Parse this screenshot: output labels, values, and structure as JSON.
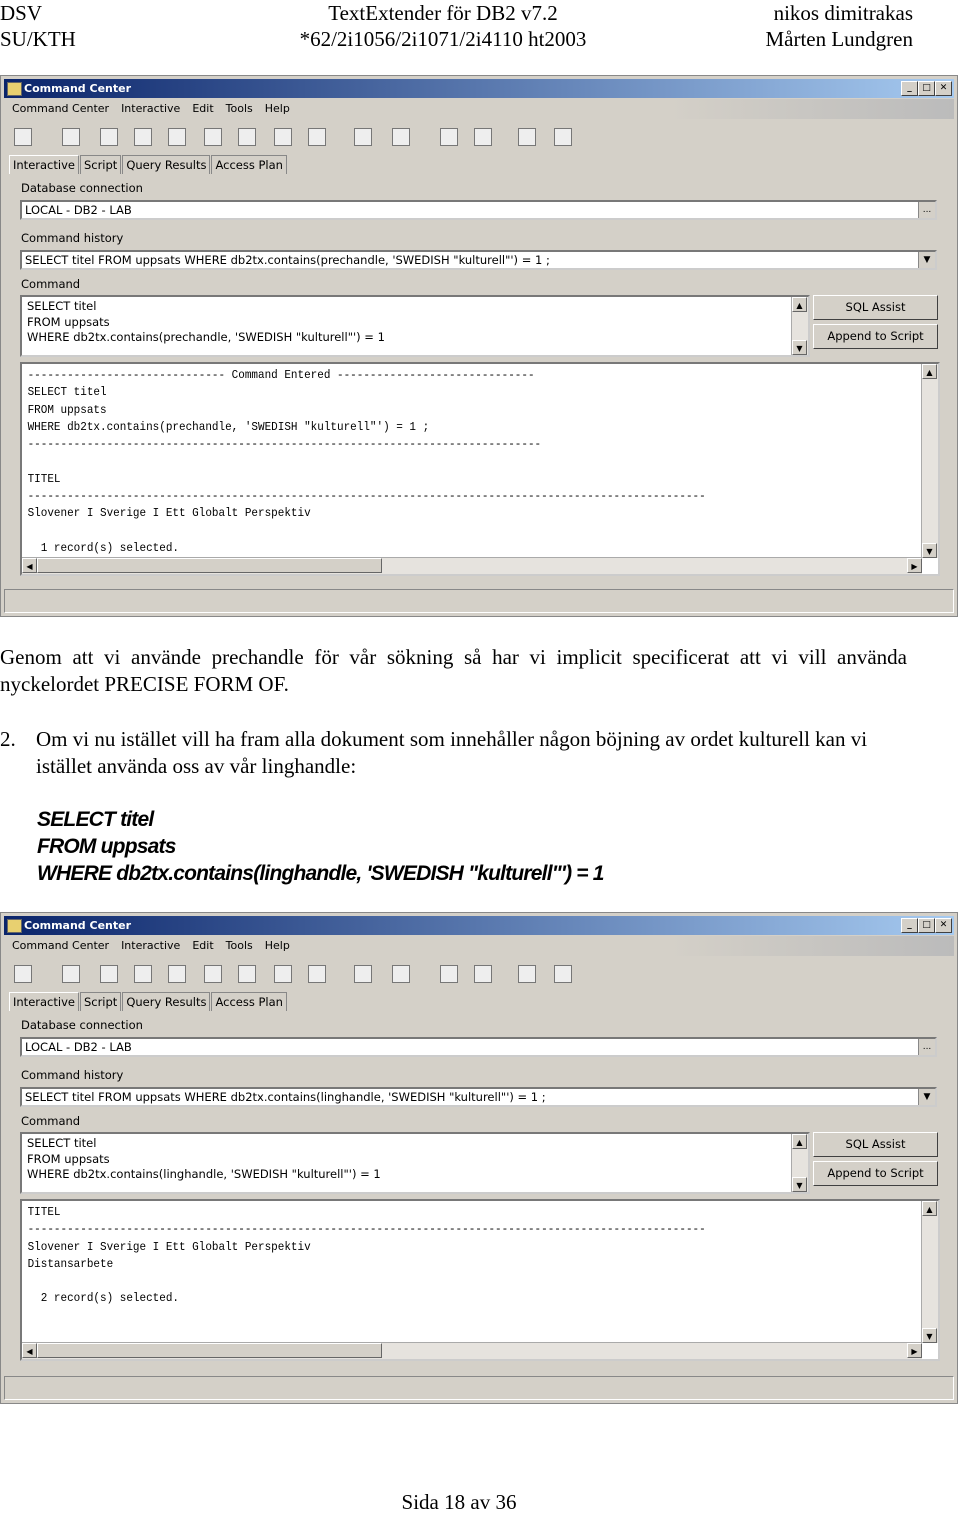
{
  "header": {
    "left1": "DSV",
    "left2": "SU/KTH",
    "center1": "TextExtender för DB2 v7.2",
    "center2": "*62/2i1056/2i1071/2i4110 ht2003",
    "right1": "nikos dimitrakas",
    "right2": "Mårten Lundgren"
  },
  "windows": [
    {
      "title": "Command Center",
      "menu": [
        "Command Center",
        "Interactive",
        "Edit",
        "Tools",
        "Help"
      ],
      "tabs": [
        "Interactive",
        "Script",
        "Query Results",
        "Access Plan"
      ],
      "db_label": "Database connection",
      "db_value": "LOCAL - DB2 - LAB",
      "history_label": "Command history",
      "history_value": "SELECT titel FROM uppsats WHERE db2tx.contains(prechandle, 'SWEDISH \"kulturell\"') = 1 ;",
      "command_label": "Command",
      "command_lines": [
        "SELECT titel",
        "FROM uppsats",
        "WHERE db2tx.contains(prechandle, 'SWEDISH \"kulturell\"') = 1"
      ],
      "sql_assist": "SQL Assist",
      "append_script": "Append to Script",
      "output": "------------------------------ Command Entered ------------------------------\nSELECT titel\nFROM uppsats\nWHERE db2tx.contains(prechandle, 'SWEDISH \"kulturell\"') = 1 ;\n------------------------------------------------------------------------------\n\nTITEL\n-------------------------------------------------------------------------------------------------------\nSlovener I Sverige I Ett Globalt Perspektiv\n\n  1 record(s) selected."
    },
    {
      "title": "Command Center",
      "menu": [
        "Command Center",
        "Interactive",
        "Edit",
        "Tools",
        "Help"
      ],
      "tabs": [
        "Interactive",
        "Script",
        "Query Results",
        "Access Plan"
      ],
      "db_label": "Database connection",
      "db_value": "LOCAL - DB2 - LAB",
      "history_label": "Command history",
      "history_value": "SELECT titel FROM uppsats WHERE db2tx.contains(linghandle, 'SWEDISH \"kulturell\"') = 1 ;",
      "command_label": "Command",
      "command_lines": [
        "SELECT titel",
        "FROM uppsats",
        "WHERE db2tx.contains(linghandle, 'SWEDISH \"kulturell\"') = 1"
      ],
      "sql_assist": "SQL Assist",
      "append_script": "Append to Script",
      "output": "TITEL\n-------------------------------------------------------------------------------------------------------\nSlovener I Sverige I Ett Globalt Perspektiv\nDistansarbete\n\n  2 record(s) selected."
    }
  ],
  "body": {
    "para1": "Genom att vi använde prechandle för vår sökning så har vi implicit specificerat att vi vill använda nyckelordet PRECISE FORM OF.",
    "item2_number": "2.",
    "item2_text": "Om vi nu istället vill ha fram alla dokument som innehåller någon böjning av ordet kulturell kan vi istället använda oss av vår linghandle:",
    "code": [
      "SELECT titel",
      "FROM uppsats",
      "WHERE db2tx.contains(linghandle, 'SWEDISH \"kulturell\"') = 1"
    ]
  },
  "footer": "Sida 18 av 36"
}
